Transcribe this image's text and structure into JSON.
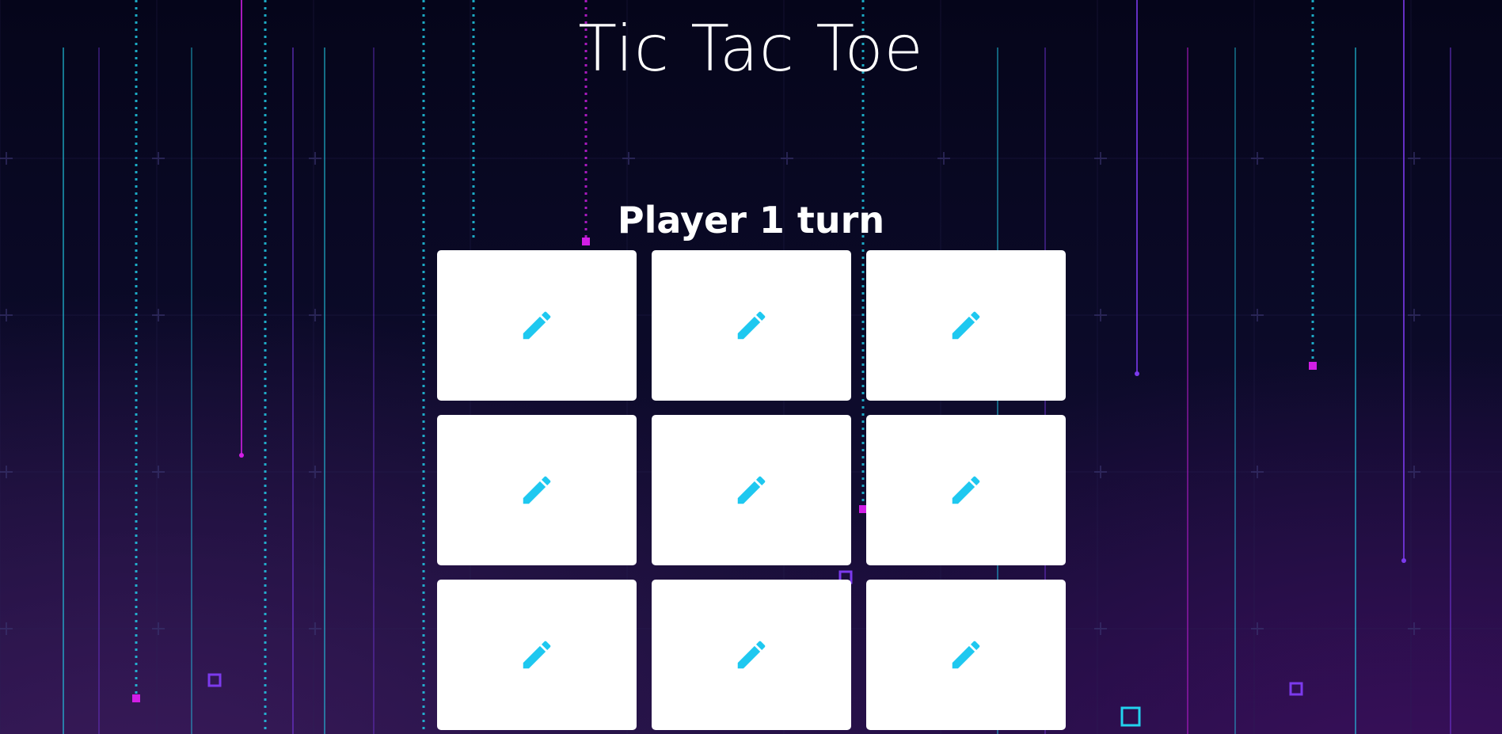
{
  "title": "Tic Tac Toe",
  "status": "Player 1 turn",
  "colors": {
    "background": "#05051a",
    "cell": "#ffffff",
    "icon": "#1ec8f0",
    "neon_cyan": "#22d3ee",
    "neon_magenta": "#d21ee6",
    "neon_violet": "#7c3aed"
  },
  "board": {
    "cells": [
      {
        "row": 1,
        "col": 1,
        "icon": "pencil-icon",
        "mark": ""
      },
      {
        "row": 1,
        "col": 2,
        "icon": "pencil-icon",
        "mark": ""
      },
      {
        "row": 1,
        "col": 3,
        "icon": "pencil-icon",
        "mark": ""
      },
      {
        "row": 2,
        "col": 1,
        "icon": "pencil-icon",
        "mark": ""
      },
      {
        "row": 2,
        "col": 2,
        "icon": "pencil-icon",
        "mark": ""
      },
      {
        "row": 2,
        "col": 3,
        "icon": "pencil-icon",
        "mark": ""
      },
      {
        "row": 3,
        "col": 1,
        "icon": "pencil-icon",
        "mark": ""
      },
      {
        "row": 3,
        "col": 2,
        "icon": "pencil-icon",
        "mark": ""
      },
      {
        "row": 3,
        "col": 3,
        "icon": "pencil-icon",
        "mark": ""
      }
    ]
  }
}
